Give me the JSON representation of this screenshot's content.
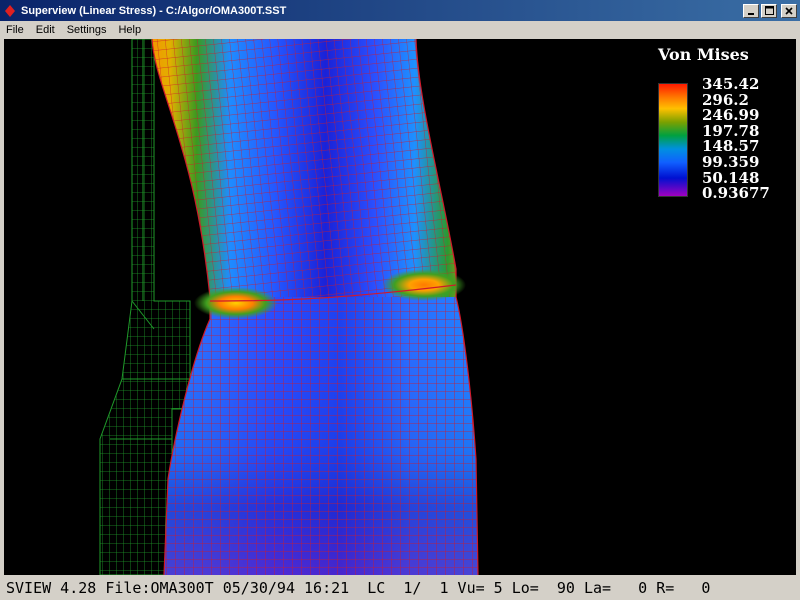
{
  "window": {
    "title": "Superview (Linear Stress) - C:/Algor/OMA300T.SST",
    "app_icon": "algor-red-diamond-icon",
    "buttons": [
      "minimize-icon",
      "maximize-icon",
      "close-icon"
    ]
  },
  "menu": {
    "items": [
      "File",
      "Edit",
      "Settings",
      "Help"
    ]
  },
  "viewport": {
    "background": "#000000",
    "mesh_colors": {
      "undeformed_mesh": "#1f9a2a",
      "deformed_mesh": "#c8102e"
    }
  },
  "legend": {
    "title": "Von Mises",
    "values": [
      "345.42",
      "296.2",
      "246.99",
      "197.78",
      "148.57",
      "99.359",
      "50.148",
      "0.93677"
    ]
  },
  "status": {
    "text": "SVIEW 4.28 File:OMA300T 05/30/94 16:21  LC  1/  1 Vu= 5 Lo=  90 La=   0 R=   0"
  }
}
